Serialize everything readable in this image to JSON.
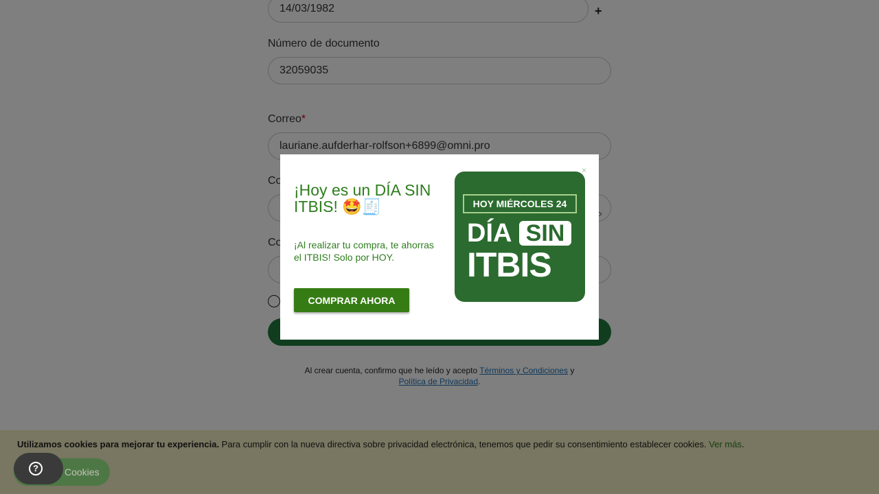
{
  "form": {
    "birthdate_value": "14/03/1982",
    "add_symbol": "+",
    "doc_number_label": "Número de documento",
    "doc_number_value": "32059035",
    "email_label": "Correo",
    "required_mark": "*",
    "email_value": "lauriane.aufderhar-rolfson+6899@omni.pro",
    "password_label_partial": "Co",
    "confirm_label_partial": "Co"
  },
  "terms": {
    "prefix": "Al crear cuenta, confirmo que he leído y acepto ",
    "terms_link": "Términos y Condiciones",
    "middle": " y",
    "privacy_link": "Política de Privacidad",
    "suffix": "."
  },
  "modal": {
    "close_symbol": "×",
    "title": "¡Hoy es un DÍA SIN ITBIS! 🤩🧾",
    "subtitle": "¡Al realizar tu compra, te ahorras el ITBIS! Solo por HOY.",
    "cta_label": "COMPRAR AHORA",
    "promo": {
      "date": "HOY MIÉRCOLES 24",
      "dia": "DÍA",
      "sin": "SIN",
      "itbis": "ITBIS"
    }
  },
  "cookies": {
    "bold_text": "Utilizamos cookies para mejorar tu experiencia.",
    "text": " Para cumplir con la nueva directiva sobre privacidad electrónica, tenemos que pedir su consentimiento establecer cookies.",
    "more_link": "Ver más",
    "more_suffix": ".",
    "button_label": "Cookies",
    "help_symbol": "?"
  },
  "colors": {
    "brand_green": "#2e7d1e",
    "button_green": "#367c14",
    "promo_green": "#2b6b2f",
    "cookie_bg": "#f2edc2"
  }
}
